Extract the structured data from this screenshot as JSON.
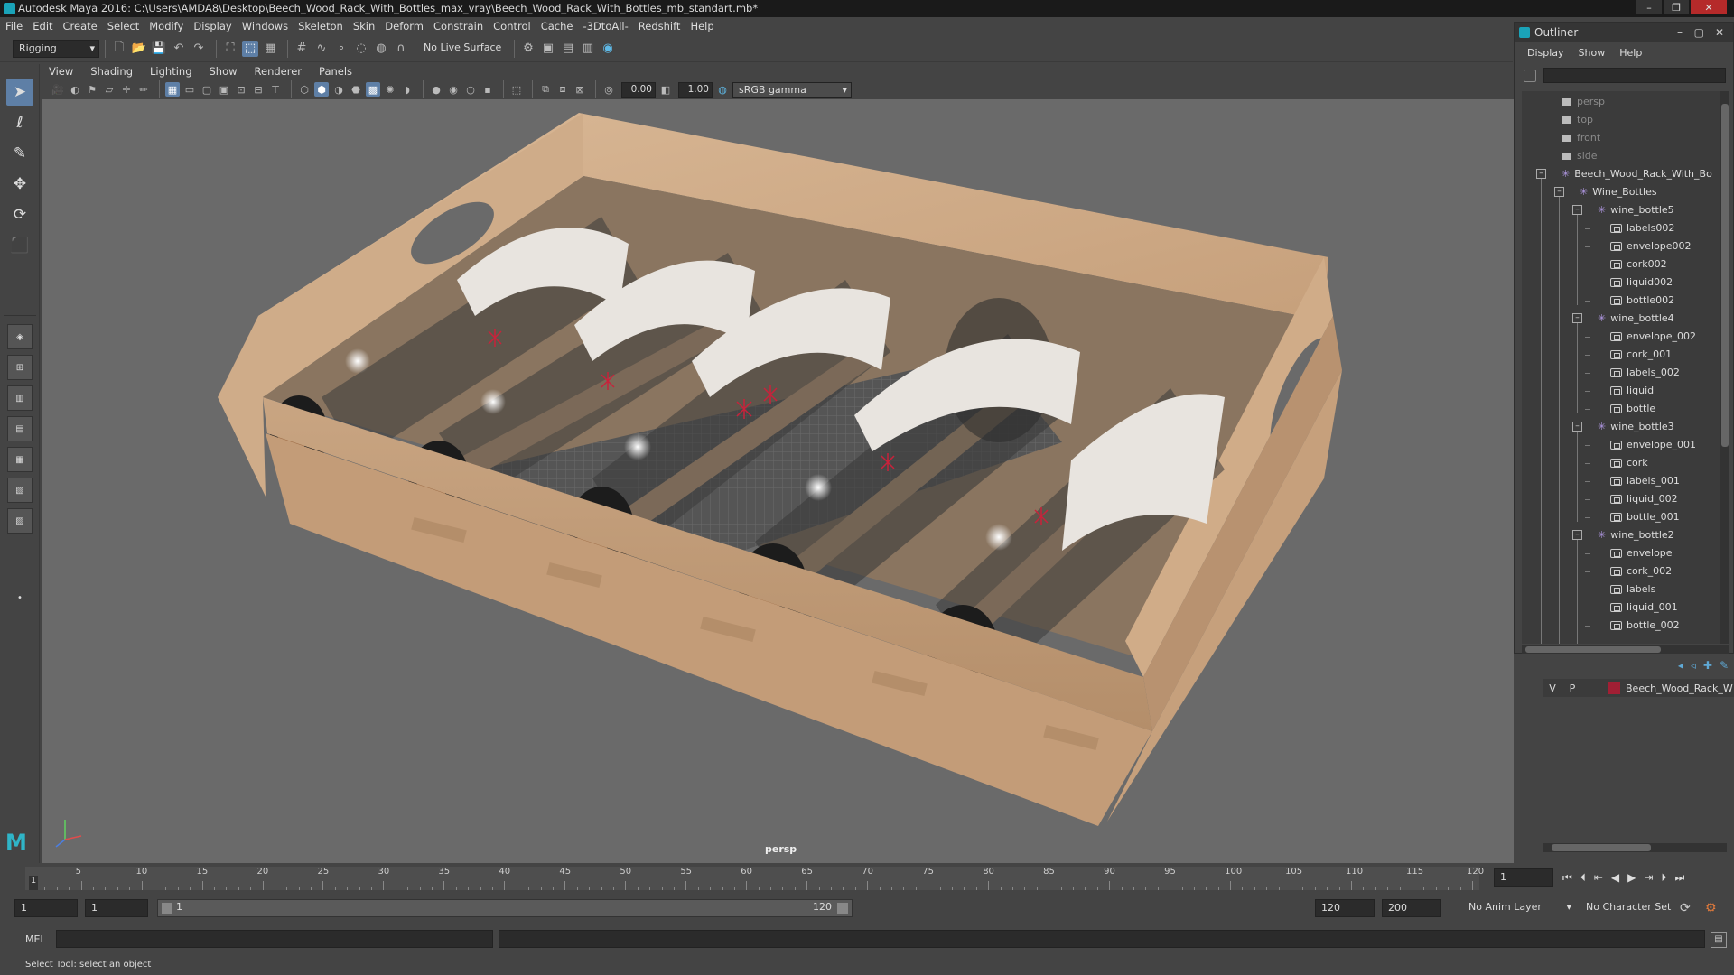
{
  "window": {
    "title": "Autodesk Maya 2016: C:\\Users\\AMDA8\\Desktop\\Beech_Wood_Rack_With_Bottles_max_vray\\Beech_Wood_Rack_With_Bottles_mb_standart.mb*",
    "accent": "#5e7fa6"
  },
  "menubar": [
    "File",
    "Edit",
    "Create",
    "Select",
    "Modify",
    "Display",
    "Windows",
    "Skeleton",
    "Skin",
    "Deform",
    "Constrain",
    "Control",
    "Cache",
    "-3DtoAll-",
    "Redshift",
    "Help"
  ],
  "shelf": {
    "mode": "Rigging",
    "live_surface": "No Live Surface"
  },
  "panel": {
    "menus": [
      "View",
      "Shading",
      "Lighting",
      "Show",
      "Renderer",
      "Panels"
    ],
    "exposure": "0.00",
    "gamma": "1.00",
    "color_space": "sRGB gamma",
    "camera_label": "persp"
  },
  "outliner": {
    "title": "Outliner",
    "menus": [
      "Display",
      "Show",
      "Help"
    ],
    "cameras": [
      "persp",
      "top",
      "front",
      "side"
    ],
    "root": "Beech_Wood_Rack_With_Bo",
    "group": "Wine_Bottles",
    "bottles": [
      {
        "name": "wine_bottle5",
        "children": [
          "labels002",
          "envelope002",
          "cork002",
          "liquid002",
          "bottle002"
        ]
      },
      {
        "name": "wine_bottle4",
        "children": [
          "envelope_002",
          "cork_001",
          "labels_002",
          "liquid",
          "bottle"
        ]
      },
      {
        "name": "wine_bottle3",
        "children": [
          "envelope_001",
          "cork",
          "labels_001",
          "liquid_002",
          "bottle_001"
        ]
      },
      {
        "name": "wine_bottle2",
        "children": [
          "envelope",
          "cork_002",
          "labels",
          "liquid_001",
          "bottle_002"
        ]
      }
    ]
  },
  "layer": {
    "v": "V",
    "p": "P",
    "name": "Beech_Wood_Rack_W",
    "color": "#a11f34"
  },
  "timeline": {
    "ticks": [
      5,
      10,
      15,
      20,
      25,
      30,
      35,
      40,
      45,
      50,
      55,
      60,
      65,
      70,
      75,
      80,
      85,
      90,
      95,
      100,
      105,
      110,
      115,
      120
    ],
    "current": "1",
    "start_max": 120
  },
  "range": {
    "start": "1",
    "playback_start": "1",
    "slider_start": "1",
    "slider_end": "120",
    "playback_end": "120",
    "end": "200",
    "anim_layer": "No Anim Layer",
    "char_set": "No Character Set"
  },
  "cmd": {
    "label": "MEL"
  },
  "status": {
    "text": "Select Tool: select an object"
  }
}
